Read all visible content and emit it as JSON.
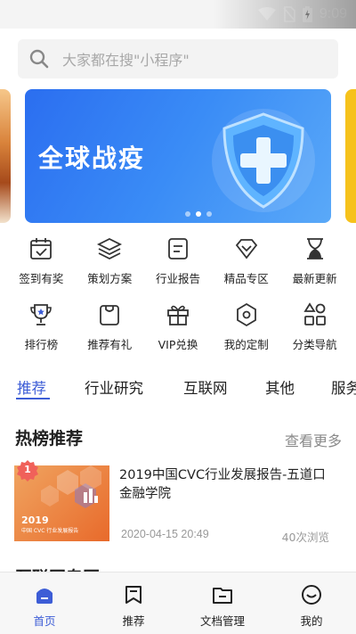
{
  "status_bar": {
    "time": "9:09"
  },
  "search": {
    "placeholder": "大家都在搜\"小程序\"",
    "icon": "search-icon"
  },
  "banner": {
    "title": "全球战疫",
    "slide_count": 3,
    "active_slide": 1
  },
  "quick_menu": [
    {
      "label": "签到有奖",
      "icon": "calendar-check-icon"
    },
    {
      "label": "策划方案",
      "icon": "layers-icon"
    },
    {
      "label": "行业报告",
      "icon": "report-icon"
    },
    {
      "label": "精品专区",
      "icon": "diamond-icon"
    },
    {
      "label": "最新更新",
      "icon": "hourglass-icon"
    },
    {
      "label": "排行榜",
      "icon": "trophy-icon"
    },
    {
      "label": "推荐有礼",
      "icon": "bag-icon"
    },
    {
      "label": "VIP兑换",
      "icon": "gift-icon"
    },
    {
      "label": "我的定制",
      "icon": "hexagon-icon"
    },
    {
      "label": "分类导航",
      "icon": "category-icon"
    }
  ],
  "tabs": [
    {
      "label": "推荐",
      "active": true
    },
    {
      "label": "行业研究",
      "active": false
    },
    {
      "label": "互联网",
      "active": false
    },
    {
      "label": "其他",
      "active": false
    },
    {
      "label": "服务",
      "active": false
    }
  ],
  "hot_section": {
    "title": "热榜推荐",
    "more_label": "查看更多"
  },
  "articles": [
    {
      "rank": "1",
      "title": "2019中国CVC行业发展报告-五道口金融学院",
      "date": "2020-04-15 20:49",
      "views": "40次浏览",
      "thumb_year": "2019",
      "thumb_subtitle": "中国 CVC 行业发展报告"
    }
  ],
  "next_section_peek": "互联网专区",
  "bottom_nav": [
    {
      "label": "首页",
      "icon": "home-icon",
      "active": true
    },
    {
      "label": "推荐",
      "icon": "bookmark-icon",
      "active": false
    },
    {
      "label": "文档管理",
      "icon": "folder-icon",
      "active": false
    },
    {
      "label": "我的",
      "icon": "smile-icon",
      "active": false
    }
  ],
  "colors": {
    "accent": "#3d5dd6",
    "banner": "#2b6ef0",
    "badge": "#f0615a"
  }
}
